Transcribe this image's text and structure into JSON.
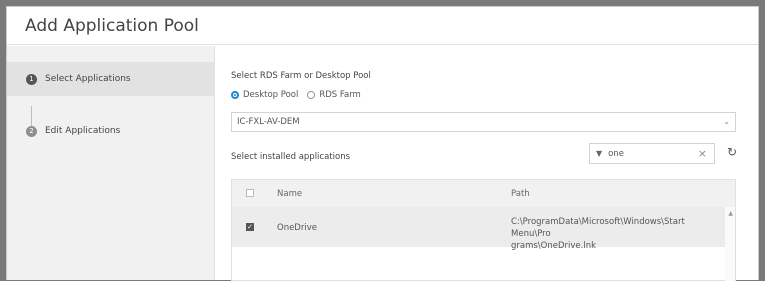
{
  "dialog": {
    "title": "Add Application Pool"
  },
  "sidebar": {
    "steps": [
      {
        "number": "1",
        "label": "Select Applications"
      },
      {
        "number": "2",
        "label": "Edit Applications"
      }
    ]
  },
  "content": {
    "source_label": "Select RDS Farm or Desktop Pool",
    "radio_options": [
      {
        "label": "Desktop Pool",
        "checked": true
      },
      {
        "label": "RDS Farm",
        "checked": false
      }
    ],
    "pool_select": {
      "value": "IC-FXL-AV-DEM",
      "arrow": "chevron-down-icon"
    },
    "apps_label": "Select installed applications",
    "filter": {
      "value": "one",
      "icon": "filter-icon",
      "clear": "close-icon"
    },
    "refresh_icon": "refresh-icon",
    "table": {
      "columns": [
        "Name",
        "Path"
      ],
      "rows": [
        {
          "checked": true,
          "name": "OneDrive",
          "path_line1": "C:\\ProgramData\\Microsoft\\Windows\\Start Menu\\Pro",
          "path_line2": "grams\\OneDrive.lnk"
        }
      ]
    }
  }
}
